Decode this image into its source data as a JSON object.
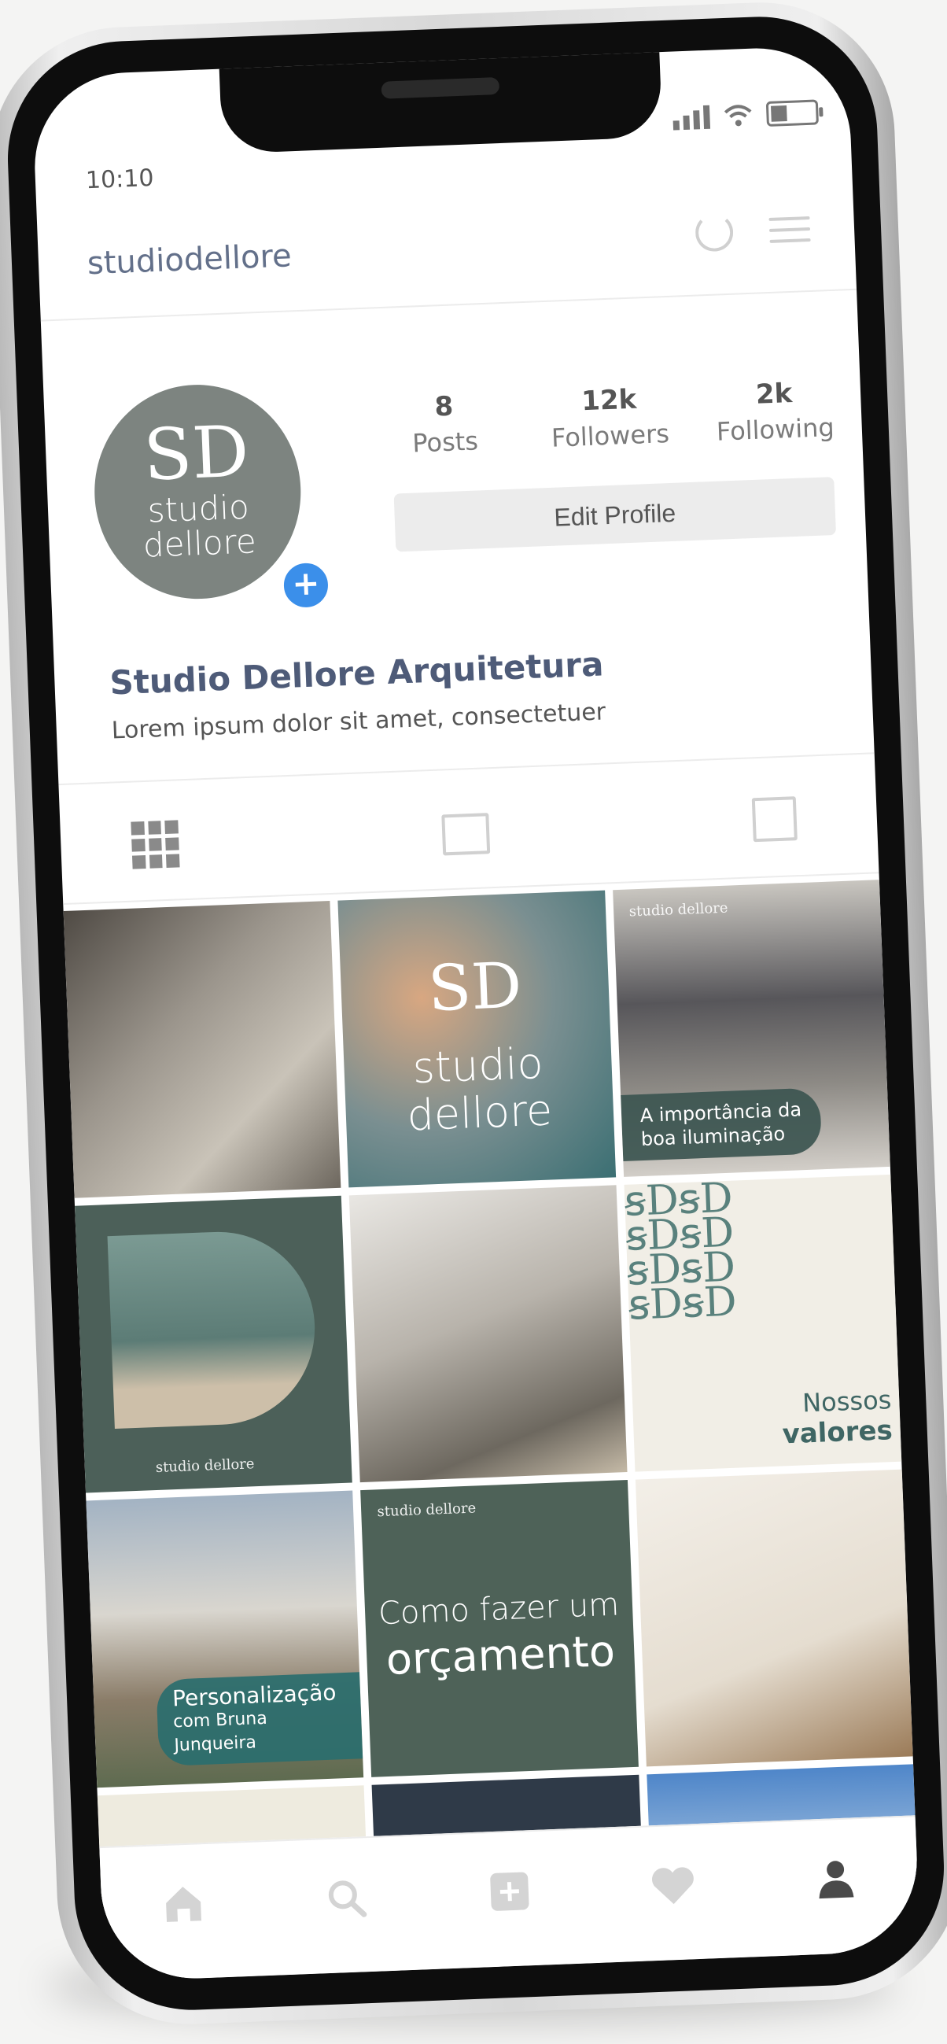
{
  "status_bar": {
    "time": "10:10"
  },
  "header": {
    "username": "studiodellore"
  },
  "profile": {
    "avatar_monogram": "SD",
    "avatar_line1": "studio",
    "avatar_line2": "dellore",
    "add_symbol": "+",
    "stats": [
      {
        "value": "8",
        "label": "Posts"
      },
      {
        "value": "12k",
        "label": "Followers"
      },
      {
        "value": "2k",
        "label": "Following"
      }
    ],
    "edit_label": "Edit Profile",
    "display_name": "Studio Dellore Arquitetura",
    "bio": "Lorem ipsum dolor sit amet, consectetuer"
  },
  "posts": {
    "brand_small": "studio dellore",
    "post2_monogram": "SD",
    "post2_line1": "studio",
    "post2_line2": "dellore",
    "post3_line1": "A importância da",
    "post3_line2": "boa iluminação",
    "post6_line1": "Nossos",
    "post6_line2": "valores",
    "post7_line1": "Personalização",
    "post7_line2": "com Bruna Junqueira",
    "post8_line1": "Como fazer um",
    "post8_line2": "orçamento"
  },
  "colors": {
    "accent": "#3b8fea",
    "brand_green": "#4c6059",
    "username_blue": "#63708a"
  },
  "icons": {
    "nav": [
      "home-icon",
      "search-icon",
      "add-post-icon",
      "heart-icon",
      "profile-icon"
    ]
  }
}
